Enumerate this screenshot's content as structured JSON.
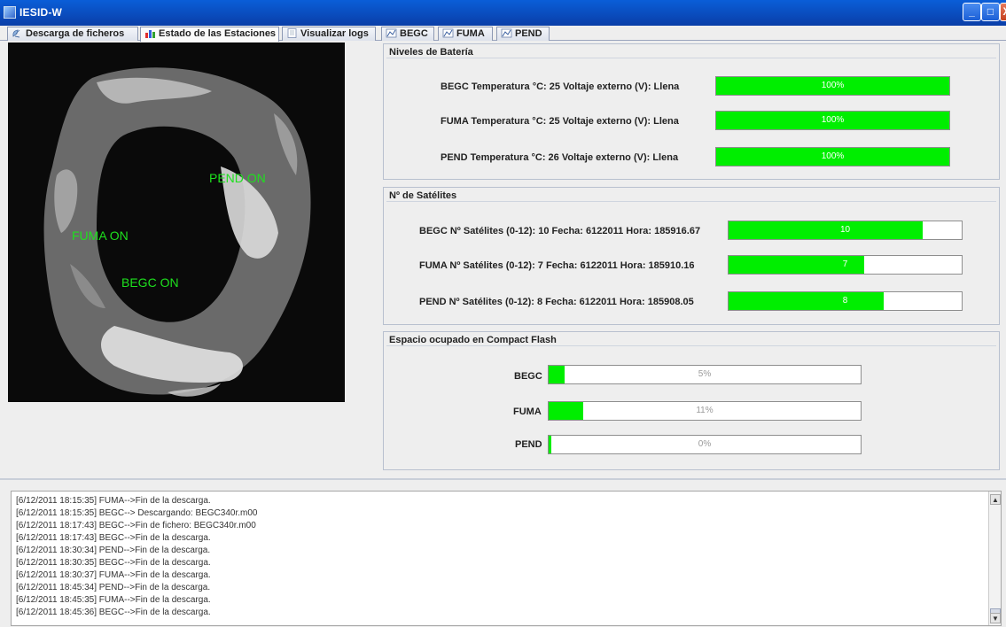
{
  "window": {
    "title": "IESID-W",
    "min_glyph": "_",
    "max_glyph": "□",
    "close_glyph": "X"
  },
  "tabs": [
    {
      "label": "Descarga de ficheros",
      "icon": "satellite-dish-icon"
    },
    {
      "label": "Estado de las Estaciones",
      "icon": "bar-chart-icon"
    },
    {
      "label": "Visualizar logs",
      "icon": "document-icon"
    },
    {
      "label": "BEGC",
      "icon": "chart-icon"
    },
    {
      "label": "FUMA",
      "icon": "chart-icon"
    },
    {
      "label": "PEND",
      "icon": "chart-icon"
    }
  ],
  "active_tab": 1,
  "map": {
    "labels": [
      {
        "name": "pend-status-label",
        "text": "PEND ON"
      },
      {
        "name": "fuma-status-label",
        "text": "FUMA ON"
      },
      {
        "name": "begc-status-label",
        "text": "BEGC ON"
      }
    ],
    "label_color": "#1ee01e"
  },
  "battery": {
    "title": "Niveles de Batería",
    "rows": [
      {
        "text": "BEGC   Temperatura °C: 25     Voltaje externo (V): Llena",
        "value": 100,
        "label": "100%"
      },
      {
        "text": "FUMA   Temperatura °C: 25     Voltaje externo (V): Llena",
        "value": 100,
        "label": "100%"
      },
      {
        "text": "PEND   Temperatura °C: 26     Voltaje externo (V): Llena",
        "value": 100,
        "label": "100%"
      }
    ]
  },
  "satellites": {
    "title": "Nº de Satélites",
    "rows": [
      {
        "text": "BEGC   Nº Satélites (0-12): 10     Fecha: 6122011     Hora: 185916.67",
        "value": 10,
        "max": 12,
        "label": "10"
      },
      {
        "text": "FUMA   Nº Satélites (0-12): 7       Fecha: 6122011     Hora: 185910.16",
        "value": 7,
        "max": 12,
        "label": "7"
      },
      {
        "text": "PEND   Nº Satélites (0-12): 8       Fecha: 6122011     Hora: 185908.05",
        "value": 8,
        "max": 12,
        "label": "8"
      }
    ]
  },
  "flash": {
    "title": "Espacio ocupado en Compact Flash",
    "rows": [
      {
        "text": "BEGC",
        "value": 5,
        "label": "5%"
      },
      {
        "text": "FUMA",
        "value": 11,
        "label": "11%"
      },
      {
        "text": "PEND",
        "value": 0,
        "label": "0%"
      }
    ]
  },
  "log": {
    "lines": [
      "[6/12/2011 18:15:35] FUMA-->Fin de la descarga.",
      "[6/12/2011 18:15:35] BEGC--> Descargando: BEGC340r.m00",
      "[6/12/2011 18:17:43] BEGC-->Fin de fichero: BEGC340r.m00",
      "[6/12/2011 18:17:43] BEGC-->Fin de la descarga.",
      "[6/12/2011 18:30:34] PEND-->Fin de la descarga.",
      "[6/12/2011 18:30:35] BEGC-->Fin de la descarga.",
      "[6/12/2011 18:30:37] FUMA-->Fin de la descarga.",
      "[6/12/2011 18:45:34] PEND-->Fin de la descarga.",
      "[6/12/2011 18:45:35] FUMA-->Fin de la descarga.",
      "[6/12/2011 18:45:36] BEGC-->Fin de la descarga."
    ],
    "scroll_up_glyph": "▲",
    "scroll_down_glyph": "▼"
  },
  "colors": {
    "progress_fill": "#00ee00",
    "titlebar": "#0a4fc8"
  }
}
